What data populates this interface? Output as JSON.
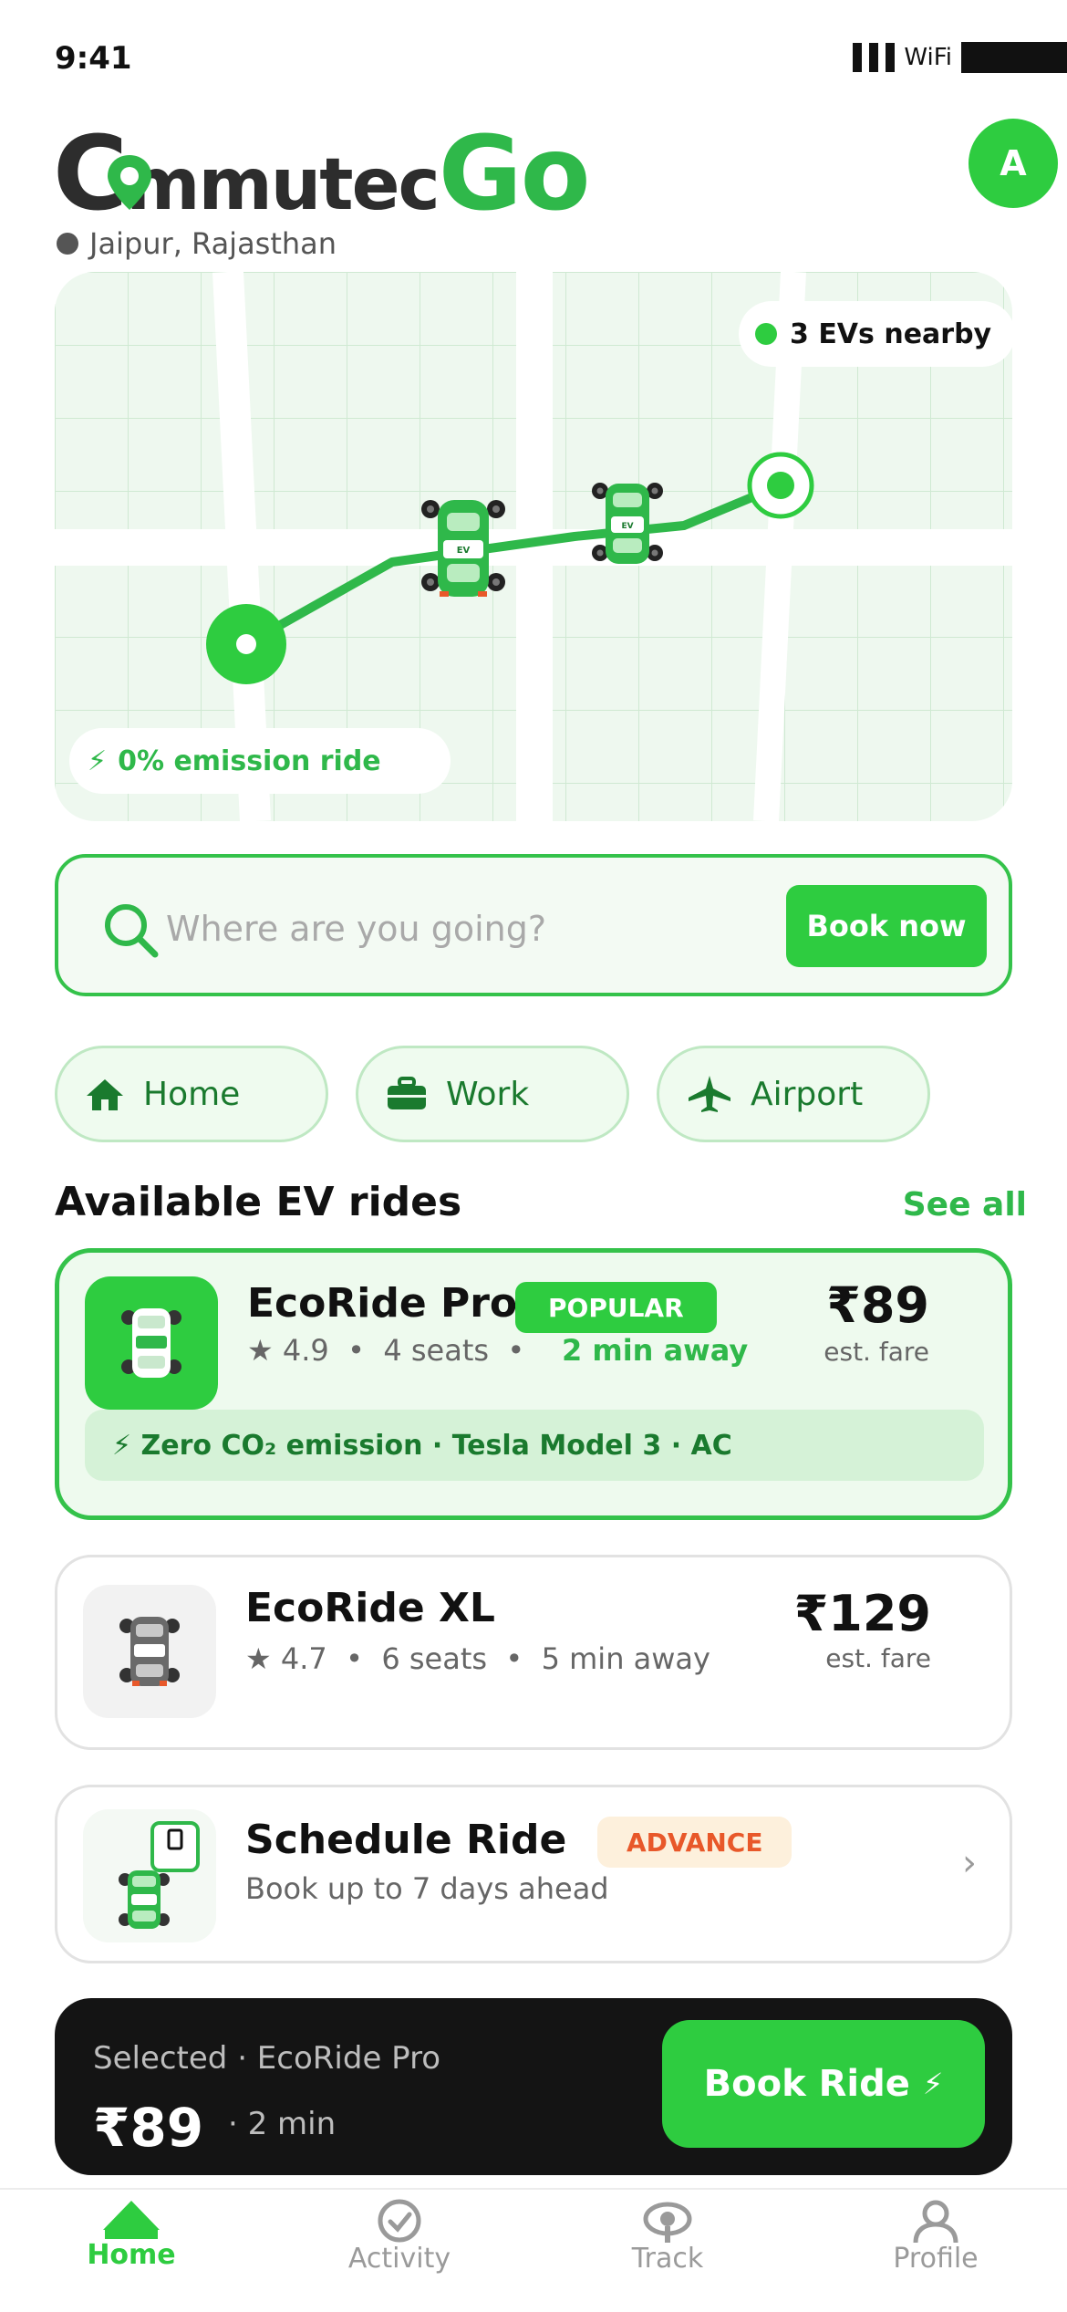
{
  "status_bar": {
    "time": "9:41",
    "wifi": "WiFi"
  },
  "header": {
    "logo_part1": "C",
    "logo_part2": "mmutec",
    "logo_part3": "Go",
    "location": "Jaipur, Rajasthan",
    "avatar_initial": "A"
  },
  "map": {
    "nearby_label": "3 EVs nearby",
    "emission_label": "0% emission ride",
    "car_tag": "EV"
  },
  "search": {
    "placeholder": "Where are you going?",
    "button": "Book now"
  },
  "quick_places": [
    {
      "label": "Home",
      "icon": "home-icon"
    },
    {
      "label": "Work",
      "icon": "briefcase-icon"
    },
    {
      "label": "Airport",
      "icon": "airplane-icon"
    }
  ],
  "section": {
    "title": "Available EV rides",
    "see_all": "See all"
  },
  "rides": [
    {
      "name": "EcoRide Pro",
      "badge": "POPULAR",
      "rating": "4.9",
      "seats": "4 seats",
      "eta": "2 min away",
      "price": "₹89",
      "price_note": "est. fare",
      "features": "Zero CO₂ emission · Tesla Model 3 · AC",
      "selected": true
    },
    {
      "name": "EcoRide XL",
      "rating": "4.7",
      "seats": "6 seats",
      "eta": "5 min away",
      "price": "₹129",
      "price_note": "est. fare",
      "selected": false
    }
  ],
  "schedule": {
    "title": "Schedule Ride",
    "badge": "ADVANCE",
    "subtitle": "Book up to 7 days ahead"
  },
  "bottom_bar": {
    "selected_label": "Selected · EcoRide Pro",
    "price": "₹89",
    "eta": "· 2 min",
    "button": "Book Ride"
  },
  "tabs": [
    {
      "label": "Home",
      "icon": "home-icon",
      "active": true
    },
    {
      "label": "Activity",
      "icon": "check-circle-icon",
      "active": false
    },
    {
      "label": "Track",
      "icon": "location-pin-icon",
      "active": false
    },
    {
      "label": "Profile",
      "icon": "person-icon",
      "active": false
    }
  ],
  "colors": {
    "accent": "#2ecc40",
    "dark": "#141414",
    "advance": "#e8582a"
  }
}
